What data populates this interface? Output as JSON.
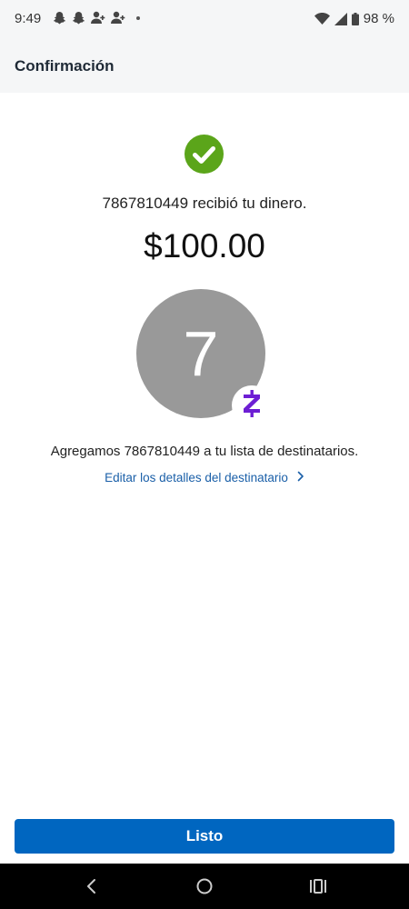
{
  "status_bar": {
    "time": "9:49",
    "battery": "98 %",
    "notification_icons": [
      "snapchat-icon",
      "snapchat-icon",
      "person-add-icon",
      "person-add-icon",
      "dot-icon"
    ],
    "system_icons": [
      "wifi-icon",
      "signal-icon",
      "battery-icon"
    ]
  },
  "header": {
    "title": "Confirmación"
  },
  "confirmation": {
    "status_icon": "check-circle-icon",
    "status_color": "#5ba51a",
    "received_text": "7867810449 recibió tu dinero.",
    "amount": "$100.00",
    "avatar_initial": "7",
    "avatar_color": "#999999",
    "badge_icon": "zelle-icon",
    "badge_color": "#6d1ed4",
    "added_text": "Agregamos 7867810449 a tu lista de destinatarios.",
    "edit_link": "Editar los detalles del destinatario"
  },
  "footer": {
    "done_label": "Listo",
    "button_color": "#0066c0"
  },
  "nav": {
    "back": "back-icon",
    "home": "home-icon",
    "recents": "recents-icon"
  }
}
